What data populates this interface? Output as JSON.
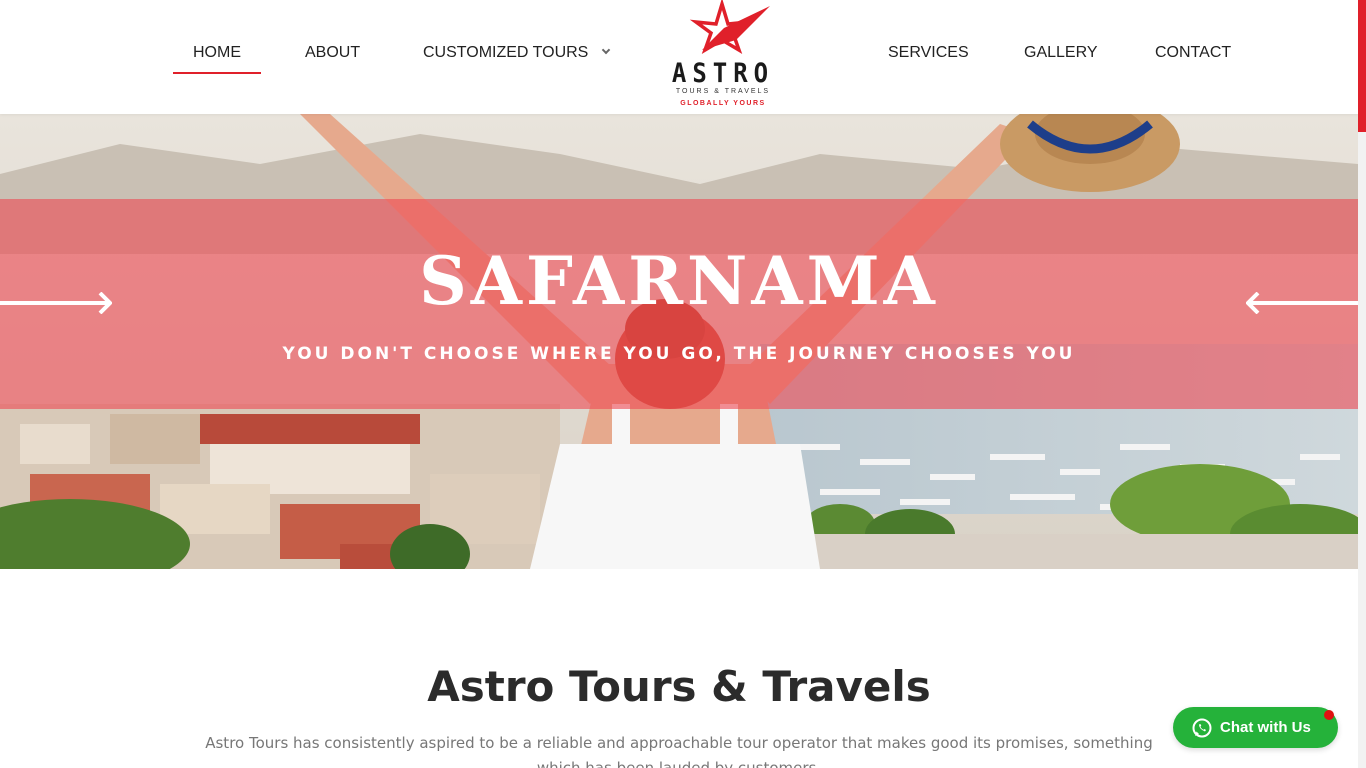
{
  "nav": {
    "left": [
      {
        "label": "HOME",
        "active": true
      },
      {
        "label": "ABOUT"
      },
      {
        "label": "CUSTOMIZED TOURS",
        "has_dropdown": true
      }
    ],
    "right": [
      {
        "label": "SERVICES"
      },
      {
        "label": "GALLERY"
      },
      {
        "label": "CONTACT"
      }
    ]
  },
  "logo": {
    "word": "ASTRO",
    "sub": "TOURS & TRAVELS",
    "tagline": "GLOBALLY YOURS"
  },
  "hero": {
    "title": "SAFARNAMA",
    "subtitle": "YOU DON'T CHOOSE WHERE YOU GO, THE JOURNEY CHOOSES YOU"
  },
  "about": {
    "title": "Astro Tours & Travels",
    "text": "Astro Tours has consistently aspired to be a reliable and approachable tour operator that makes good its promises, something which has been lauded by customers."
  },
  "chat": {
    "label": "Chat with Us"
  },
  "colors": {
    "accent": "#e0202a",
    "band": "#ee4c56",
    "chat": "#25b23a"
  }
}
